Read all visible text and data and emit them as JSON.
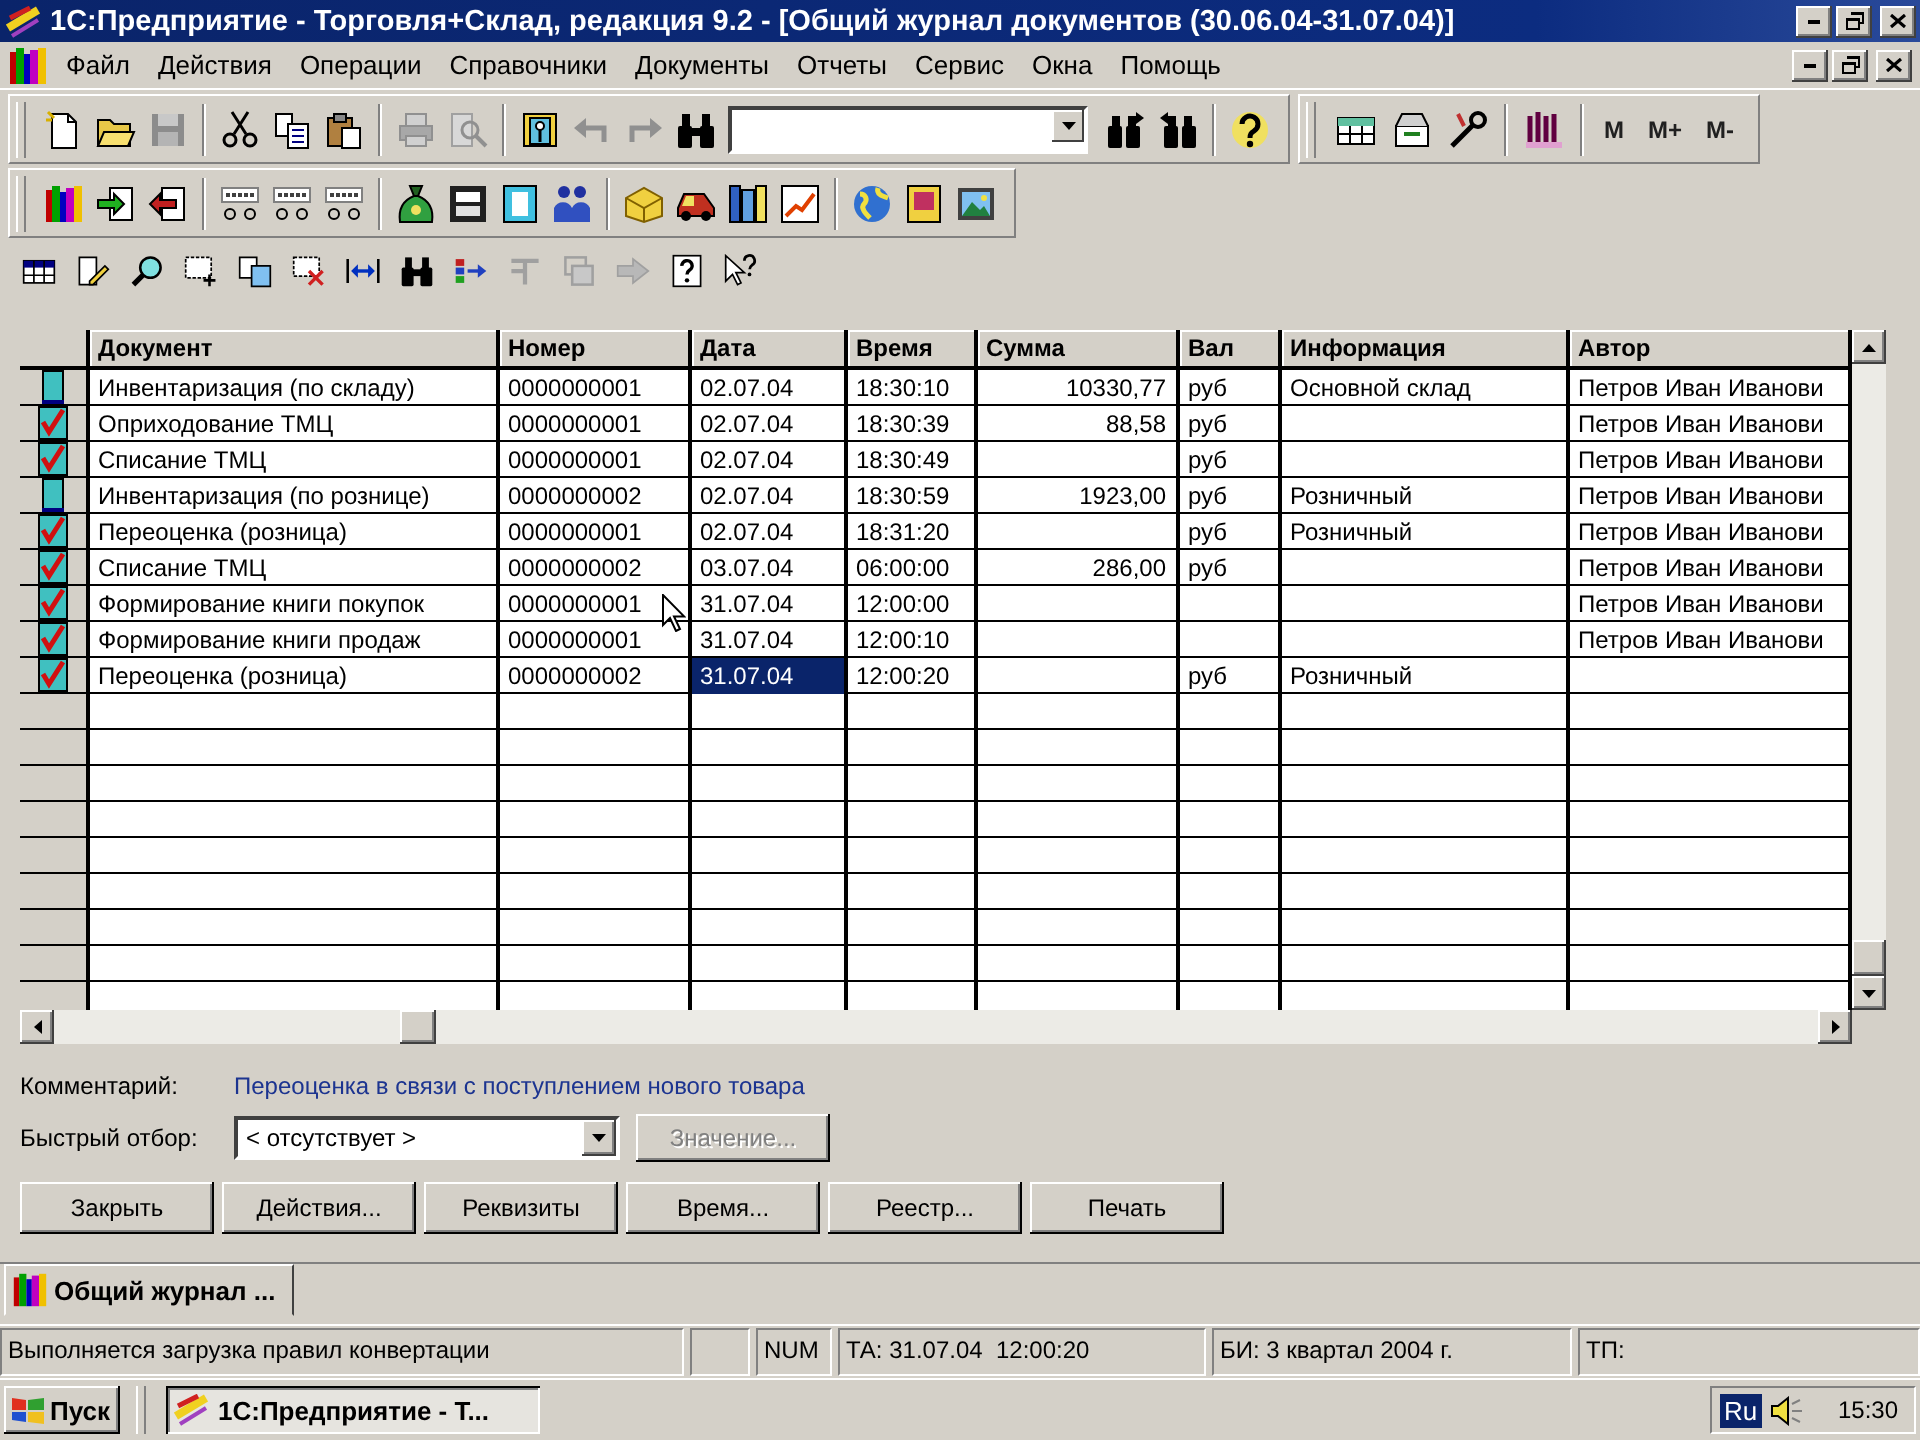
{
  "window": {
    "title": "1С:Предприятие - Торговля+Склад, редакция 9.2 - [Общий журнал документов (30.06.04-31.07.04)]"
  },
  "menu": {
    "items": [
      "Файл",
      "Действия",
      "Операции",
      "Справочники",
      "Документы",
      "Отчеты",
      "Сервис",
      "Окна",
      "Помощь"
    ]
  },
  "toolbar": {
    "memory_buttons": [
      "M",
      "M+",
      "M-"
    ]
  },
  "table": {
    "columns": [
      "Документ",
      "Номер",
      "Дата",
      "Время",
      "Сумма",
      "Вал",
      "Информация",
      "Автор"
    ],
    "rows": [
      {
        "posted": false,
        "selected": false,
        "document": "Инвентаризация (по складу)",
        "number": "0000000001",
        "date": "02.07.04",
        "time": "18:30:10",
        "sum": "10330,77",
        "currency": "руб",
        "info": "Основной склад",
        "author": "Петров Иван Иванови"
      },
      {
        "posted": true,
        "selected": false,
        "document": "Оприходование ТМЦ",
        "number": "0000000001",
        "date": "02.07.04",
        "time": "18:30:39",
        "sum": "88,58",
        "currency": "руб",
        "author": "Петров Иван Иванови"
      },
      {
        "posted": true,
        "selected": false,
        "document": "Списание ТМЦ",
        "number": "0000000001",
        "date": "02.07.04",
        "time": "18:30:49",
        "currency": "руб",
        "author": "Петров Иван Иванови"
      },
      {
        "posted": false,
        "selected": false,
        "document": "Инвентаризация (по рознице)",
        "number": "0000000002",
        "date": "02.07.04",
        "time": "18:30:59",
        "sum": "1923,00",
        "currency": "руб",
        "info": "Розничный",
        "author": "Петров Иван Иванови"
      },
      {
        "posted": true,
        "selected": false,
        "document": "Переоценка (розница)",
        "number": "0000000001",
        "date": "02.07.04",
        "time": "18:31:20",
        "currency": "руб",
        "info": "Розничный",
        "author": "Петров Иван Иванови"
      },
      {
        "posted": true,
        "selected": false,
        "document": "Списание ТМЦ",
        "number": "0000000002",
        "date": "03.07.04",
        "time": "06:00:00",
        "sum": "286,00",
        "currency": "руб",
        "author": "Петров Иван Иванови"
      },
      {
        "posted": true,
        "selected": false,
        "document": "Формирование книги покупок",
        "number": "0000000001",
        "date": "31.07.04",
        "time": "12:00:00",
        "author": "Петров Иван Иванови"
      },
      {
        "posted": true,
        "selected": false,
        "document": "Формирование книги продаж",
        "number": "0000000001",
        "date": "31.07.04",
        "time": "12:00:10",
        "author": "Петров Иван Иванови"
      },
      {
        "posted": true,
        "selected": true,
        "document": "Переоценка (розница)",
        "number": "0000000002",
        "date": "31.07.04",
        "time": "12:00:20",
        "currency": "руб",
        "info": "Розничный"
      }
    ]
  },
  "comment": {
    "label": "Комментарий:",
    "value": "Переоценка в связи с поступлением нового товара"
  },
  "filter": {
    "label": "Быстрый отбор:",
    "value": "< отсутствует >",
    "button": {
      "label": "Значение...",
      "disabled": true
    }
  },
  "buttons": [
    "Закрыть",
    "Действия...",
    "Реквизиты",
    "Время...",
    "Реестр...",
    "Печать"
  ],
  "window_tabs": [
    {
      "label": "Общий журнал ...",
      "selected": true
    }
  ],
  "status_bar": {
    "message": "Выполняется загрузка правил конвертации",
    "panels": [
      "NUM",
      "ТА: 31.07.04  12:00:20",
      "БИ: 3 квартал 2004 г.",
      "ТП:"
    ]
  },
  "taskbar": {
    "start": "Пуск",
    "tasks": [
      {
        "label": "1С:Предприятие - Т...",
        "selected": true
      }
    ],
    "language": "Ru",
    "clock": "15:30"
  }
}
